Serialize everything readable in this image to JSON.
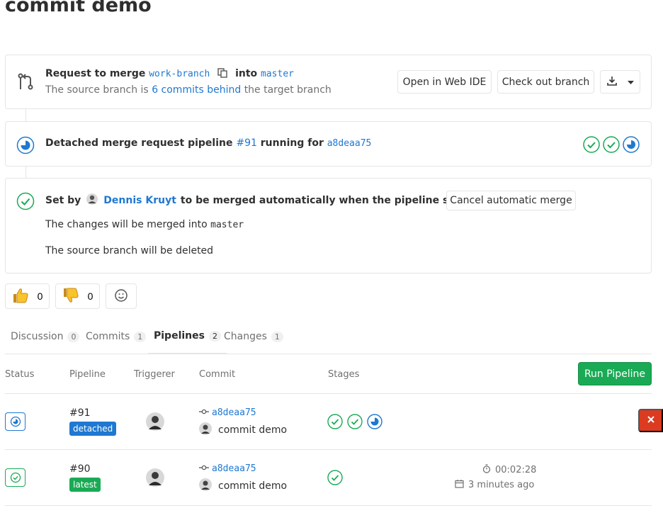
{
  "page": {
    "title": "commit demo"
  },
  "merge_widget": {
    "label_request": "Request to merge",
    "source_branch": "work-branch",
    "label_into": "into",
    "target_branch": "master",
    "behind_prefix": "The source branch is",
    "behind_link": "6 commits behind",
    "behind_suffix": "the target branch",
    "btn_web_ide": "Open in Web IDE",
    "btn_checkout": "Check out branch"
  },
  "pipeline_widget": {
    "prefix": "Detached merge request pipeline",
    "pipeline_link": "#91",
    "running_for": "running for",
    "commit_sha": "a8deaa75",
    "stages": [
      "success",
      "success",
      "running"
    ]
  },
  "auto_merge": {
    "set_by": "Set by",
    "user": "Dennis Kruyt",
    "message": "to be merged automatically when the pipeline succeeds",
    "cancel_button": "Cancel automatic merge",
    "info_merge_prefix": "The changes will be merged into",
    "info_merge_branch": "master",
    "info_delete": "The source branch will be deleted"
  },
  "awards": {
    "thumbsup_count": "0",
    "thumbsdown_count": "0"
  },
  "tabs": [
    {
      "label": "Discussion",
      "count": "0"
    },
    {
      "label": "Commits",
      "count": "1"
    },
    {
      "label": "Pipelines",
      "count": "2",
      "active": true
    },
    {
      "label": "Changes",
      "count": "1"
    }
  ],
  "table": {
    "headers": {
      "status": "Status",
      "pipeline": "Pipeline",
      "triggerer": "Triggerer",
      "commit": "Commit",
      "stages": "Stages"
    },
    "run_pipeline": "Run Pipeline",
    "rows": [
      {
        "status": "running",
        "id": "#91",
        "badge": "detached",
        "badge_color": "#1f78d1",
        "sha": "a8deaa75",
        "title": "commit demo",
        "stages": [
          "success",
          "success",
          "running"
        ],
        "duration": "",
        "finished": ""
      },
      {
        "status": "success",
        "id": "#90",
        "badge": "latest",
        "badge_color": "#1aaa55",
        "sha": "a8deaa75",
        "title": "commit demo",
        "stages": [
          "success"
        ],
        "duration": "00:02:28",
        "finished": "3 minutes ago"
      }
    ]
  },
  "colors": {
    "success": "#1aaa55",
    "running": "#1f78d1",
    "danger": "#db3b21",
    "link": "#1f78d1"
  }
}
